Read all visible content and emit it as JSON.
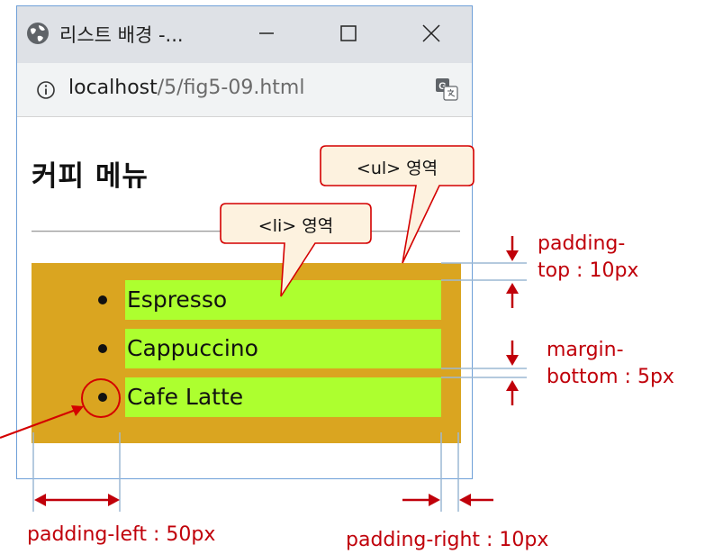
{
  "window": {
    "tab_title": "리스트 배경 -...",
    "address": {
      "host": "localhost",
      "path": "/5/fig5-09.html"
    }
  },
  "page": {
    "title": "커피 메뉴",
    "list_items": [
      "Espresso",
      "Cappuccino",
      "Cafe Latte"
    ]
  },
  "callouts": {
    "ul": "<ul> 영역",
    "li": "<li> 영역"
  },
  "annotations": {
    "padding_top_line1": "padding-",
    "padding_top_line2": "top : 10px",
    "margin_bottom_line1": "margin-",
    "margin_bottom_line2": "bottom :  5px",
    "padding_left": "padding-left : 50px",
    "padding_right": "padding-right : 10px"
  },
  "colors": {
    "ul_background": "#daa520",
    "li_background": "#adff2f",
    "annotation_red": "#c0000a",
    "guide_line": "#9cb8d4",
    "callout_fill": "#fdf2df"
  }
}
